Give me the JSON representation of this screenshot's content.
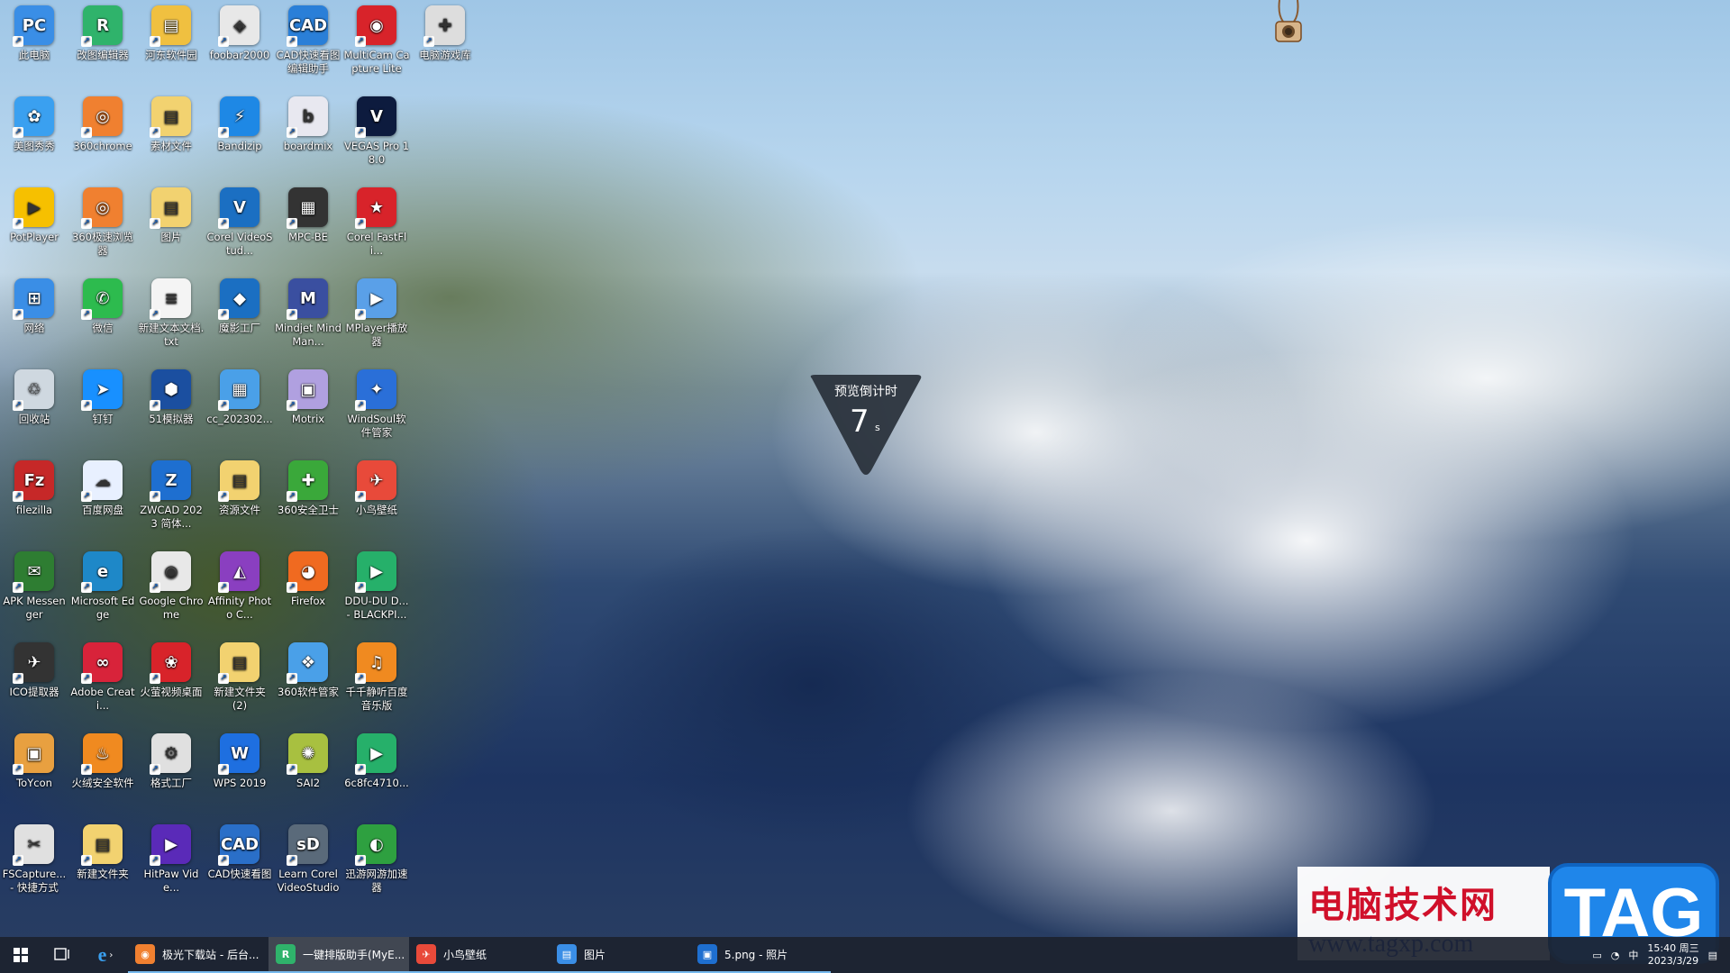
{
  "desktop": {
    "icons": [
      {
        "label": "此电脑",
        "color": "#3a8ee6",
        "glyph": "PC"
      },
      {
        "label": "改图编辑器",
        "color": "#2fb36b",
        "glyph": "R"
      },
      {
        "label": "河东软件园",
        "color": "#f0c040",
        "glyph": "▤"
      },
      {
        "label": "foobar2000",
        "color": "#e8e8e8",
        "glyph": "◈"
      },
      {
        "label": "CAD快速看图 编辑助手",
        "color": "#2a7fd8",
        "glyph": "CAD"
      },
      {
        "label": "MultiCam Capture Lite",
        "color": "#d8232a",
        "glyph": "◉"
      },
      {
        "label": "电脑游戏库",
        "color": "#dddddd",
        "glyph": "✚"
      },
      {
        "label": "美图秀秀",
        "color": "#3aa0f0",
        "glyph": "✿"
      },
      {
        "label": "360chrome",
        "color": "#f08030",
        "glyph": "◎"
      },
      {
        "label": "素材文件",
        "color": "#f2d270",
        "glyph": "▤"
      },
      {
        "label": "Bandizip",
        "color": "#1e88e5",
        "glyph": "⚡"
      },
      {
        "label": "boardmix",
        "color": "#e8e8f0",
        "glyph": "b"
      },
      {
        "label": "VEGAS Pro 18.0",
        "color": "#0d1b3e",
        "glyph": "V"
      },
      {
        "label": "PotPlayer",
        "color": "#f6c000",
        "glyph": "▶"
      },
      {
        "label": "360极速浏览器",
        "color": "#f08030",
        "glyph": "◎"
      },
      {
        "label": "图片",
        "color": "#f2d270",
        "glyph": "▤"
      },
      {
        "label": "Corel VideoStud...",
        "color": "#1b6fc2",
        "glyph": "V"
      },
      {
        "label": "MPC-BE",
        "color": "#333333",
        "glyph": "▦"
      },
      {
        "label": "Corel FastFli...",
        "color": "#d8232a",
        "glyph": "★"
      },
      {
        "label": "网络",
        "color": "#3a8ee6",
        "glyph": "⊞"
      },
      {
        "label": "微信",
        "color": "#2dbb4e",
        "glyph": "✆"
      },
      {
        "label": "新建文本文档.txt",
        "color": "#f4f4f4",
        "glyph": "≡"
      },
      {
        "label": "魔影工厂",
        "color": "#1b6fc2",
        "glyph": "◆"
      },
      {
        "label": "Mindjet MindMan...",
        "color": "#3a4fa0",
        "glyph": "M"
      },
      {
        "label": "MPlayer播放器",
        "color": "#5aa0e8",
        "glyph": "▶"
      },
      {
        "label": "回收站",
        "color": "#cfd8e0",
        "glyph": "♲"
      },
      {
        "label": "钉钉",
        "color": "#1890ff",
        "glyph": "➤"
      },
      {
        "label": "51模拟器",
        "color": "#1b4fa0",
        "glyph": "⬢"
      },
      {
        "label": "cc_202302...",
        "color": "#4aa0e8",
        "glyph": "▦"
      },
      {
        "label": "Motrix",
        "color": "#b0a0e0",
        "glyph": "▣"
      },
      {
        "label": "WindSoul软件管家",
        "color": "#2a6fd8",
        "glyph": "✦"
      },
      {
        "label": "filezilla",
        "color": "#c62828",
        "glyph": "Fz"
      },
      {
        "label": "百度网盘",
        "color": "#e8f0ff",
        "glyph": "☁"
      },
      {
        "label": "ZWCAD 2023 简体...",
        "color": "#1e6fd0",
        "glyph": "Z"
      },
      {
        "label": "资源文件",
        "color": "#f2d270",
        "glyph": "▤"
      },
      {
        "label": "360安全卫士",
        "color": "#3aa83a",
        "glyph": "✚"
      },
      {
        "label": "小鸟壁纸",
        "color": "#e84a3a",
        "glyph": "✈"
      },
      {
        "label": "APK Messenger",
        "color": "#2e7d32",
        "glyph": "✉"
      },
      {
        "label": "Microsoft Edge",
        "color": "#1e88c8",
        "glyph": "e"
      },
      {
        "label": "Google Chrome",
        "color": "#e8e8e8",
        "glyph": "◉"
      },
      {
        "label": "Affinity Photo C...",
        "color": "#8a3fc0",
        "glyph": "◭"
      },
      {
        "label": "Firefox",
        "color": "#f06a20",
        "glyph": "◕"
      },
      {
        "label": "DDU-DU D... - BLACKPI...",
        "color": "#26b06a",
        "glyph": "▶"
      },
      {
        "label": "ICO提取器",
        "color": "#333333",
        "glyph": "✈"
      },
      {
        "label": "Adobe Creati...",
        "color": "#d8233a",
        "glyph": "∞"
      },
      {
        "label": "火萤视频桌面",
        "color": "#d8232a",
        "glyph": "❀"
      },
      {
        "label": "新建文件夹 (2)",
        "color": "#f2d270",
        "glyph": "▤"
      },
      {
        "label": "360软件管家",
        "color": "#4aa0e8",
        "glyph": "❖"
      },
      {
        "label": "千千静听百度音乐版",
        "color": "#f08a20",
        "glyph": "♫"
      },
      {
        "label": "ToYcon",
        "color": "#e8a040",
        "glyph": "▣"
      },
      {
        "label": "火绒安全软件",
        "color": "#f08a20",
        "glyph": "♨"
      },
      {
        "label": "格式工厂",
        "color": "#e0e0e0",
        "glyph": "⚙"
      },
      {
        "label": "WPS 2019",
        "color": "#1e6fe0",
        "glyph": "W"
      },
      {
        "label": "SAI2",
        "color": "#a8c040",
        "glyph": "✺"
      },
      {
        "label": "6c8fc4710...",
        "color": "#26b06a",
        "glyph": "▶"
      },
      {
        "label": "FSCapture... - 快捷方式",
        "color": "#e0e0e0",
        "glyph": "✂"
      },
      {
        "label": "新建文件夹",
        "color": "#f2d270",
        "glyph": "▤"
      },
      {
        "label": "HitPaw Vide...",
        "color": "#5a2ab8",
        "glyph": "▶"
      },
      {
        "label": "CAD快速看图",
        "color": "#2a6fc8",
        "glyph": "CAD"
      },
      {
        "label": "Learn Corel VideoStudio",
        "color": "#5a6a7a",
        "glyph": "sD"
      },
      {
        "label": "迅游网游加速器",
        "color": "#2ea040",
        "glyph": "◐"
      }
    ]
  },
  "countdown": {
    "title": "预览倒计时",
    "value": "7",
    "unit": "s"
  },
  "watermark": {
    "site_name": "电脑技术网",
    "url": "www.tagxp.com",
    "tag": "TAG"
  },
  "taskbar": {
    "items": [
      {
        "label": "极光下载站 - 后台...",
        "icon": "◉",
        "color": "#f08030",
        "active": false
      },
      {
        "label": "一键排版助手(MyE...",
        "icon": "R",
        "color": "#2fb36b",
        "active": true
      },
      {
        "label": "小鸟壁纸",
        "icon": "✈",
        "color": "#e84a3a",
        "active": false
      },
      {
        "label": "图片",
        "icon": "▤",
        "color": "#3a8ee6",
        "active": false
      },
      {
        "label": "5.png - 照片",
        "icon": "▣",
        "color": "#1e6fd0",
        "active": false
      }
    ],
    "clock_time": "15:40 周三",
    "clock_date": "2023/3/29"
  }
}
